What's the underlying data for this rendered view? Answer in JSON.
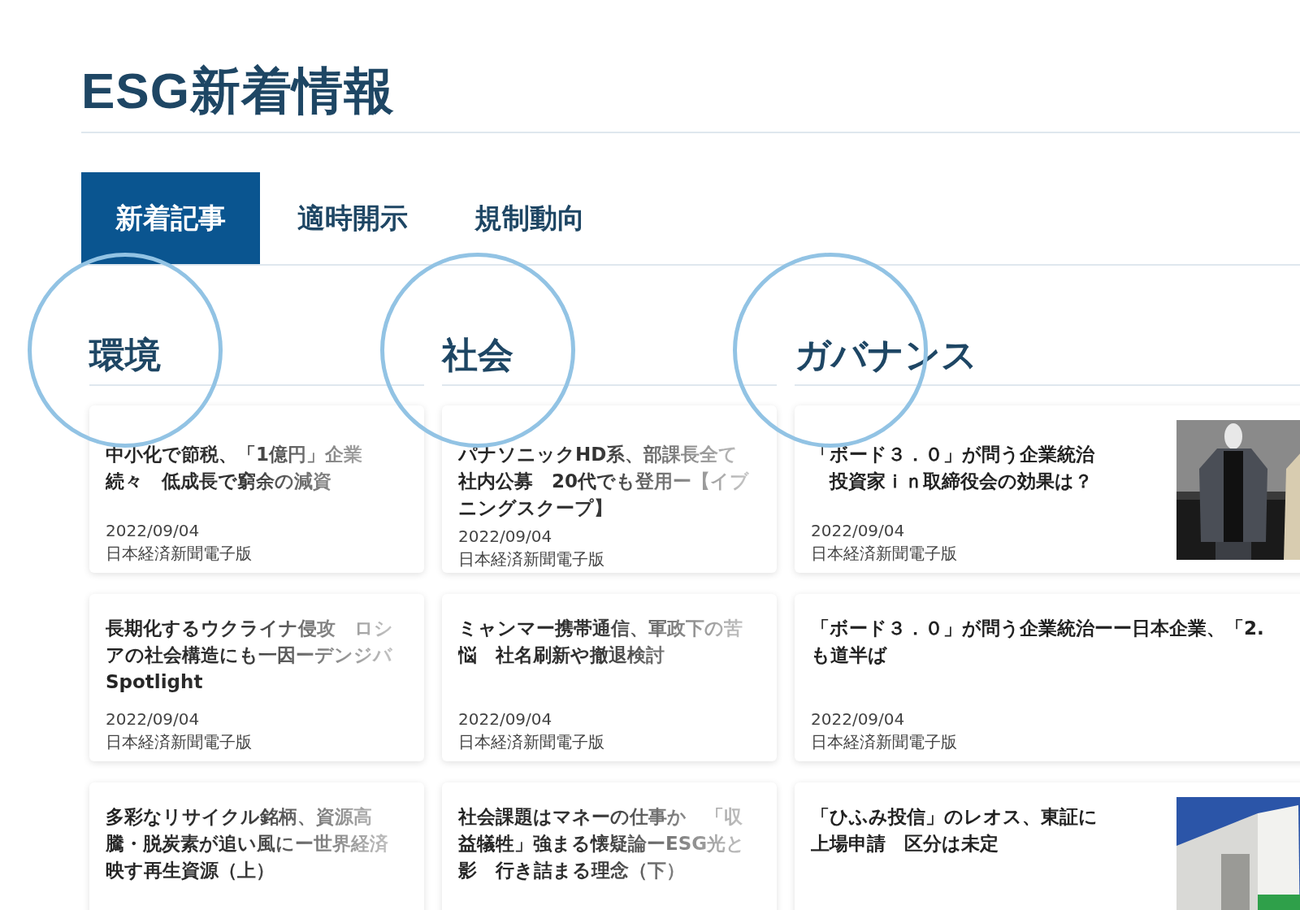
{
  "title": "ESG新着情報",
  "tabs": [
    {
      "label": "新着記事",
      "selected": true
    },
    {
      "label": "適時開示",
      "selected": false
    },
    {
      "label": "規制動向",
      "selected": false
    }
  ],
  "columns": [
    {
      "heading": "環境",
      "cards": [
        {
          "title_lines": [
            "中小化で節税、「1億円」企業",
            "続々　低成長で窮余の減資"
          ],
          "faded": true,
          "date": "2022/09/04",
          "source": "日本経済新聞電子版"
        },
        {
          "title_lines": [
            "長期化するウクライナ侵攻　ロシ",
            "アの社会構造にも一因ーデンジバ",
            "Spotlight"
          ],
          "faded": true,
          "date": "2022/09/04",
          "source": "日本経済新聞電子版"
        },
        {
          "title_lines": [
            "多彩なリサイクル銘柄、資源高",
            "騰・脱炭素が追い風にー世界経済",
            "映す再生資源（上）"
          ],
          "faded": true
        }
      ]
    },
    {
      "heading": "社会",
      "cards": [
        {
          "title_lines": [
            "パナソニックHD系、部課長全て",
            "社内公募　20代でも登用ー【イブ",
            "ニングスクープ】"
          ],
          "faded": true,
          "date": "2022/09/04",
          "source": "日本経済新聞電子版"
        },
        {
          "title_lines": [
            "ミャンマー携帯通信、軍政下の苦",
            "悩　社名刷新や撤退検討"
          ],
          "faded": true,
          "date": "2022/09/04",
          "source": "日本経済新聞電子版"
        },
        {
          "title_lines": [
            "社会課題はマネーの仕事か　「収",
            "益犠牲」強まる懐疑論ーESG光と",
            "影　行き詰まる理念（下）"
          ],
          "faded": true
        }
      ]
    },
    {
      "heading": "ガバナンス",
      "cards": [
        {
          "title_lines": [
            "「ボード３．０」が問う企業統治",
            "　投資家ｉｎ取締役会の効果は？"
          ],
          "faded": false,
          "date": "2022/09/04",
          "source": "日本経済新聞電子版",
          "image": {
            "kind": "picture"
          }
        },
        {
          "title_lines": [
            "「ボード３．０」が問う企業統治ーー日本企業、「2.",
            "も道半ば"
          ],
          "faded": false,
          "date": "2022/09/04",
          "source": "日本経済新聞電子版"
        },
        {
          "title_lines": [
            "「ひふみ投信」のレオス、東証に",
            "上場申請　区分は未定"
          ],
          "faded": false,
          "image": {
            "kind": "picture"
          }
        }
      ]
    }
  ]
}
